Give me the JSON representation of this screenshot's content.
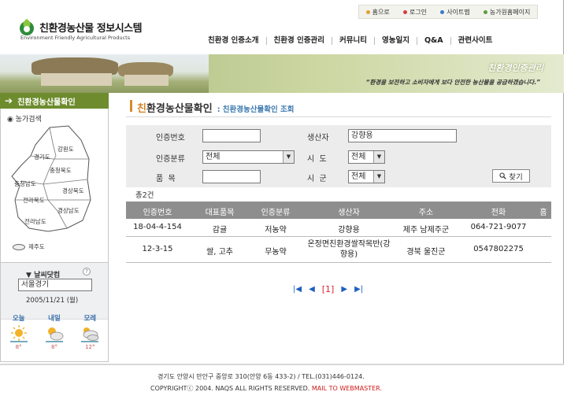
{
  "utility": {
    "home": "홈으로",
    "login": "로그인",
    "sitemap": "사이트맵",
    "farmer_page": "농가원홈페이지",
    "dot_colors": [
      "#e0a030",
      "#d04040",
      "#3a7ac8",
      "#5aa040"
    ]
  },
  "logo": {
    "title": "친환경농산물 정보시스템",
    "subtitle": "Environment Friendly Agricultural Products"
  },
  "nav": {
    "items": [
      "친환경 인증소개",
      "친환경 인증관리",
      "커뮤니티",
      "영농일지",
      "Q&A",
      "관련사이트"
    ]
  },
  "banner": {
    "heading": "친환경인증관리",
    "quote": "“환경을 보전하고 소비자에게 보다 안전한 농산물을 공급하겠습니다.”"
  },
  "sidebar": {
    "heading": "친환경농산물확인",
    "map_label": "농가검색",
    "regions": [
      "강원도",
      "경기도",
      "충청북도",
      "충청남도",
      "경상북도",
      "전라북도",
      "경상남도",
      "전라남도",
      "제주도"
    ],
    "weather": {
      "title": "날씨닷컴",
      "help": "?",
      "location": "서울경기",
      "date": "2005/11/21 (월)",
      "days": [
        {
          "name": "오늘",
          "temp": "8°",
          "icon": "sun-icon"
        },
        {
          "name": "내일",
          "temp": "8°",
          "icon": "sun-cloud-icon"
        },
        {
          "name": "모레",
          "temp": "12°",
          "icon": "cloud-icon"
        }
      ]
    }
  },
  "main": {
    "title_first": "친",
    "title_rest": "환경농산물확인",
    "subtitle": ": 친환경농산물확인 조회",
    "search": {
      "cert_no_label": "인증번호",
      "cert_no_value": "",
      "producer_label": "생산자",
      "producer_value": "강향용",
      "cert_type_label": "인증분류",
      "cert_type_value": "전체",
      "sido_label": "시  도",
      "sido_value": "전체",
      "item_label": "품  목",
      "item_value": "",
      "sigun_label": "시  군",
      "sigun_value": "전체",
      "find_label": "찾기"
    },
    "count": "총2건",
    "columns": [
      "인증번호",
      "대표품목",
      "인증분류",
      "생산자",
      "주소",
      "전화",
      "홈"
    ],
    "rows": [
      {
        "cert_no": "18-04-4-154",
        "item": "감귤",
        "type": "저농약",
        "producer": "강향용",
        "address": "제주 남제주군",
        "phone": "064-721-9077"
      },
      {
        "cert_no": "12-3-15",
        "item": "쌀, 고추",
        "type": "무농약",
        "producer_line1": "온정면친환경쌀작목반(강",
        "producer_line2": "향용)",
        "address": "경북 울진군",
        "phone": "0547802275"
      }
    ],
    "pager": {
      "current": "[1]"
    }
  },
  "footer": {
    "address": "경기도 안양시 만안구 중앙로 310(안양 6동 433-2) / TEL.(031)446-0124.",
    "copyright": "COPYRIGHTⓒ 2004. NAQS ALL RIGHTS RESERVED.",
    "mail": "MAIL TO WEBMASTER."
  }
}
